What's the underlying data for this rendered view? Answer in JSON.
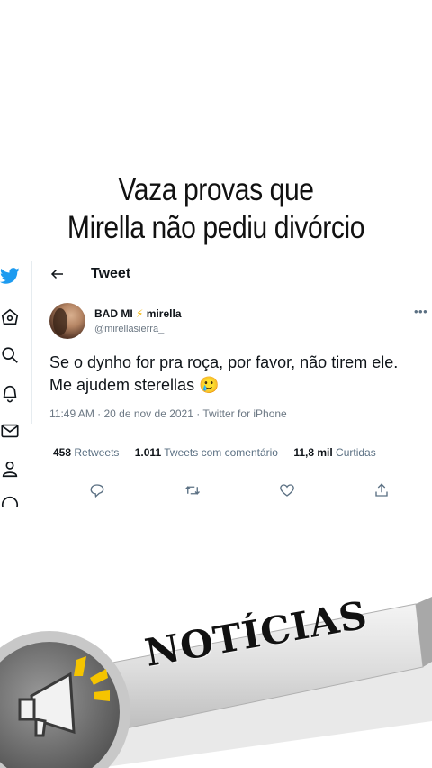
{
  "headline": {
    "line1": "Vaza provas que",
    "line2": "Mirella não pediu divórcio"
  },
  "sidebar": {
    "icons": [
      "twitter-bird-icon",
      "home-icon",
      "search-icon",
      "bell-icon",
      "mail-icon",
      "profile-icon",
      "more-icon"
    ]
  },
  "tweet": {
    "header_title": "Tweet",
    "author": {
      "display_name": "BAD MI",
      "emoji": "⚡",
      "display_name_suffix": "mirella",
      "handle": "@mirellasierra_"
    },
    "text_line1": "Se o dynho for pra roça, por favor, não tirem ele.",
    "text_line2": "Me ajudem sterellas",
    "emoji_end": "🥲",
    "meta": "11:49 AM · 20 de nov de 2021 · Twitter for iPhone",
    "stats": {
      "retweets_count": "458",
      "retweets_label": "Retweets",
      "quotes_count": "1.011",
      "quotes_label": "Tweets com comentário",
      "likes_count": "11,8 mil",
      "likes_label": "Curtidas"
    },
    "actions": [
      "reply-icon",
      "retweet-icon",
      "like-icon",
      "share-icon"
    ]
  },
  "banner": {
    "label": "NOTÍCIAS"
  },
  "colors": {
    "twitter_blue": "#1d9bf0",
    "text": "#0f1419",
    "muted": "#6b7783",
    "banner_yellow": "#f5c400",
    "banner_gray": "#8a8a8a"
  }
}
